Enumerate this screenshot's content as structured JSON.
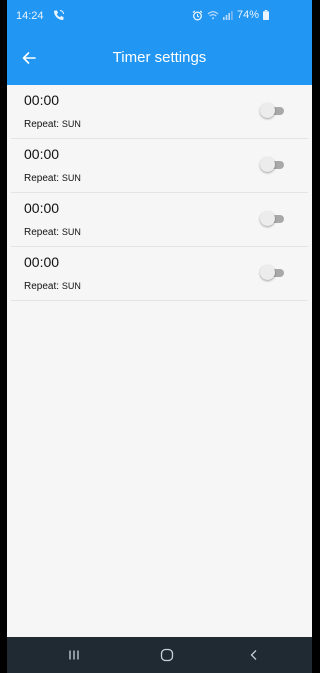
{
  "status_bar": {
    "time": "14:24",
    "battery": "74%"
  },
  "header": {
    "title": "Timer settings"
  },
  "timers": [
    {
      "time": "00:00",
      "repeat_label": "Repeat:",
      "repeat_days": "SUN",
      "enabled": false
    },
    {
      "time": "00:00",
      "repeat_label": "Repeat:",
      "repeat_days": "SUN",
      "enabled": false
    },
    {
      "time": "00:00",
      "repeat_label": "Repeat:",
      "repeat_days": "SUN",
      "enabled": false
    },
    {
      "time": "00:00",
      "repeat_label": "Repeat:",
      "repeat_days": "SUN",
      "enabled": false
    }
  ],
  "colors": {
    "app_bar": "#2196f3",
    "background": "#f6f6f6",
    "nav_bar": "#1f2a33"
  },
  "icons": {
    "back": "back-arrow-icon",
    "phone": "phone-call-icon",
    "alarm": "alarm-icon",
    "wifi": "wifi-icon",
    "signal": "signal-icon",
    "battery": "battery-icon",
    "nav_recent": "recent-apps-icon",
    "nav_home": "home-icon",
    "nav_back": "nav-back-icon"
  }
}
